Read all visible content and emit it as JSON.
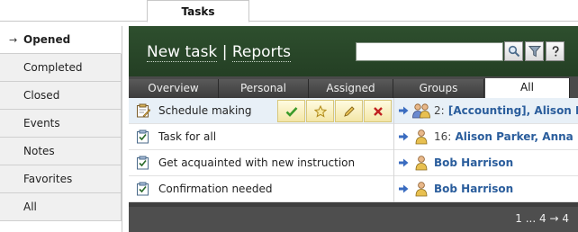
{
  "top_tab": {
    "label": "Tasks"
  },
  "sidebar": {
    "items": [
      {
        "label": "Opened",
        "active": true,
        "arrow": "→"
      },
      {
        "label": "Completed"
      },
      {
        "label": "Closed"
      },
      {
        "label": "Events"
      },
      {
        "label": "Notes"
      },
      {
        "label": "Favorites"
      },
      {
        "label": "All"
      }
    ]
  },
  "header": {
    "new_task": "New task",
    "separator": "|",
    "reports": "Reports",
    "search": {
      "value": "",
      "placeholder": ""
    }
  },
  "tabs": [
    {
      "label": "Overview"
    },
    {
      "label": "Personal"
    },
    {
      "label": "Assigned"
    },
    {
      "label": "Groups"
    },
    {
      "label": "All",
      "active": true
    }
  ],
  "rows": [
    {
      "title": "Schedule making",
      "icon": "task-edit-icon",
      "num": "2:",
      "assignees": "[Accounting], Alison Pa",
      "group": true
    },
    {
      "title": "Task for all",
      "icon": "task-checklist-icon",
      "num": "16:",
      "assignees": "Alison Parker, Anna M"
    },
    {
      "title": "Get acquainted with new instruction",
      "icon": "task-checklist-icon",
      "num": "",
      "assignees": "Bob Harrison"
    },
    {
      "title": "Confirmation needed",
      "icon": "task-checklist-icon",
      "num": "",
      "assignees": "Bob Harrison"
    }
  ],
  "pager": {
    "text": "1 ... 4",
    "next": "→",
    "last": "4"
  },
  "colors": {
    "header_green": "#2e4f2e",
    "link_blue": "#2a5d9c",
    "panel_gray": "#3f3f3f"
  }
}
